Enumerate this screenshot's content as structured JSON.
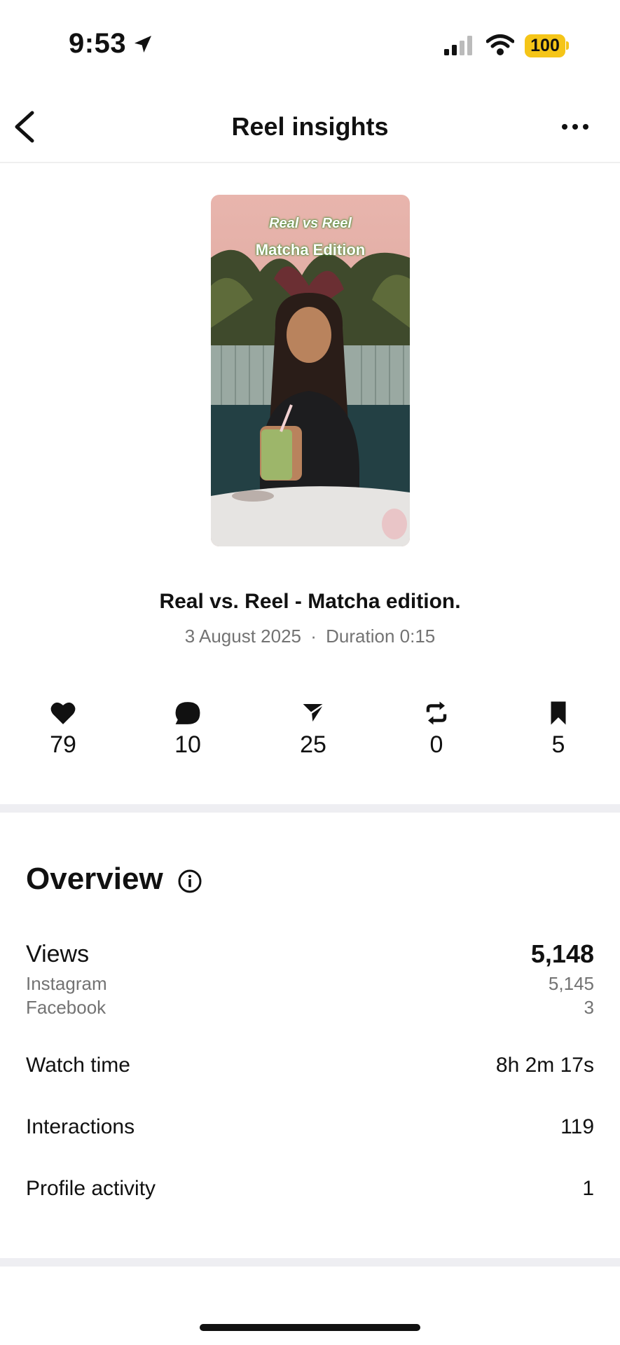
{
  "status_bar": {
    "time": "9:53",
    "battery": "100"
  },
  "nav": {
    "title": "Reel insights"
  },
  "thumbnail": {
    "line1": "Real vs Reel",
    "line2": "Matcha Edition"
  },
  "reel": {
    "title": "Real vs. Reel - Matcha edition.",
    "date": "3 August 2025",
    "separator": "·",
    "duration": "Duration 0:15"
  },
  "stats": [
    {
      "icon": "heart-icon",
      "value": "79"
    },
    {
      "icon": "comment-icon",
      "value": "10"
    },
    {
      "icon": "share-icon",
      "value": "25"
    },
    {
      "icon": "repost-icon",
      "value": "0"
    },
    {
      "icon": "bookmark-icon",
      "value": "5"
    }
  ],
  "overview": {
    "title": "Overview",
    "views": {
      "label": "Views",
      "value": "5,148",
      "instagram_label": "Instagram",
      "instagram_value": "5,145",
      "facebook_label": "Facebook",
      "facebook_value": "3"
    },
    "watch_time": {
      "label": "Watch time",
      "value": "8h 2m 17s"
    },
    "interactions": {
      "label": "Interactions",
      "value": "119"
    },
    "profile_activity": {
      "label": "Profile activity",
      "value": "1"
    }
  },
  "colors": {
    "battery": "#f5c518",
    "secondary_text": "#737373",
    "divider": "#eeeef2"
  }
}
